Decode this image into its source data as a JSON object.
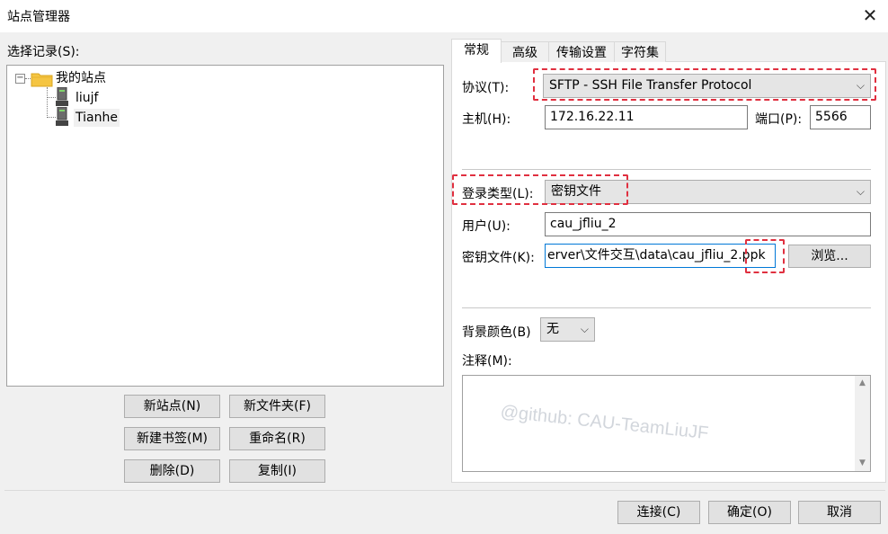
{
  "window": {
    "title": "站点管理器"
  },
  "left": {
    "select_label": "选择记录(S):",
    "tree": {
      "root": "我的站点",
      "children": [
        "liujf",
        "Tianhe"
      ]
    },
    "buttons": {
      "new_site": "新站点(N)",
      "new_folder": "新文件夹(F)",
      "new_bookmark": "新建书签(M)",
      "rename": "重命名(R)",
      "delete": "删除(D)",
      "copy": "复制(I)"
    }
  },
  "tabs": [
    "常规",
    "高级",
    "传输设置",
    "字符集"
  ],
  "general": {
    "protocol_label": "协议(T):",
    "protocol_value": "SFTP - SSH File Transfer Protocol",
    "host_label": "主机(H):",
    "host_value": "172.16.22.11",
    "port_label": "端口(P):",
    "port_value": "5566",
    "logon_type_label": "登录类型(L):",
    "logon_type_value": "密钥文件",
    "user_label": "用户(U):",
    "user_value": "cau_jfliu_2",
    "keyfile_label": "密钥文件(K):",
    "keyfile_value": "erver\\文件交互\\data\\cau_jfliu_2.ppk",
    "browse_label": "浏览...",
    "bg_color_label": "背景颜色(B)",
    "bg_color_value": "无",
    "notes_label": "注释(M):",
    "watermark": "@github: CAU-TeamLiuJF"
  },
  "footer": {
    "connect": "连接(C)",
    "ok": "确定(O)",
    "cancel": "取消"
  },
  "colors": {
    "highlight_dash": "#e03040",
    "focus_blue": "#0078d7",
    "folder_yellow": "#f5c542"
  }
}
